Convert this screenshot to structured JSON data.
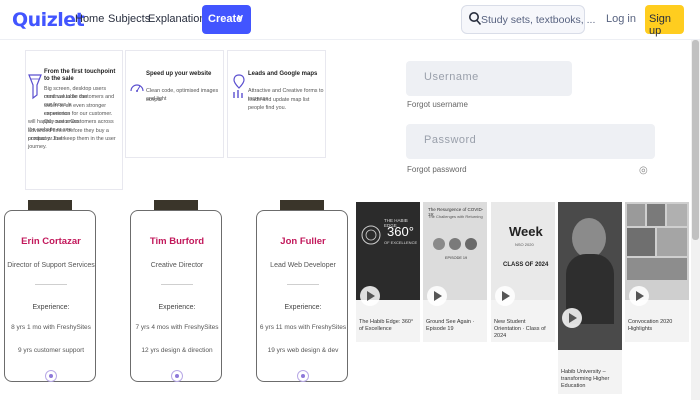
{
  "nav": {
    "logo": "Quizlet",
    "links": [
      "Home",
      "Subjects",
      "Explanations"
    ],
    "create_label": "Create",
    "search_placeholder": "Study sets, textbooks, ...",
    "login_label": "Log in",
    "signup_label": "Sign up"
  },
  "features": [
    {
      "title": "From the first touchpoint to the sale",
      "text": [
        "Big screen, desktop users continue to be the",
        "most valuable customers and our focus is",
        "widen to an even stronger conversion",
        "experience for our customer. Our customers",
        "will happily see a Customers across the website or see",
        "advanced times before they buy a product or their",
        "company. Just keep them in the user journey."
      ]
    },
    {
      "title": "Speed up your website",
      "text": [
        "Clean code, optimised images and light",
        "scripts"
      ]
    },
    {
      "title": "Leads and Google maps",
      "text": [
        "Attractive and Creative forms to increase",
        "leads and update map list people find you."
      ]
    }
  ],
  "team": [
    {
      "name": "Erin Cortazar",
      "role": "Director of Support Services",
      "experience_label": "Experience:",
      "line1": "8 yrs 1 mo with FreshySites",
      "line2": "9 yrs customer support"
    },
    {
      "name": "Tim Burford",
      "role": "Creative Director",
      "experience_label": "Experience:",
      "line1": "7 yrs 4 mos with FreshySites",
      "line2": "12 yrs design & direction"
    },
    {
      "name": "Jon Fuller",
      "role": "Lead Web Developer",
      "experience_label": "Experience:",
      "line1": "6 yrs 11 mos with FreshySites",
      "line2": "19 yrs web design & dev"
    }
  ],
  "login": {
    "username_placeholder": "Username",
    "forgot_username": "Forgot username",
    "password_placeholder": "Password",
    "forgot_password": "Forgot password"
  },
  "videos": [
    {
      "title": "The Habib Edge: 360° of Excellence",
      "thumb_caption_1": "THE HABIB EDGE",
      "thumb_caption_2": "360°",
      "thumb_caption_3": "OF EXCELLENCE"
    },
    {
      "title": "Ground See Again · Episode 19",
      "thumb_caption_1": "The Resurgence of COVID-19:",
      "thumb_caption_2": "The Challenges with Returning",
      "thumb_caption_3": "EPISODE 19"
    },
    {
      "title": "New Student Orientation · Class of 2024",
      "thumb_caption_1": "Week",
      "thumb_caption_2": "NSO 2020",
      "thumb_caption_3": "CLASS OF 2024"
    },
    {
      "title": "Habib University – transforming Higher Education",
      "thumb_caption_1": "",
      "thumb_caption_2": "",
      "thumb_caption_3": ""
    },
    {
      "title": "Convocation 2020 Highlights",
      "thumb_caption_1": "",
      "thumb_caption_2": "",
      "thumb_caption_3": ""
    }
  ],
  "colors": {
    "brand": "#4255ff",
    "signup": "#ffcd1f",
    "team_name": "#c2185b"
  }
}
